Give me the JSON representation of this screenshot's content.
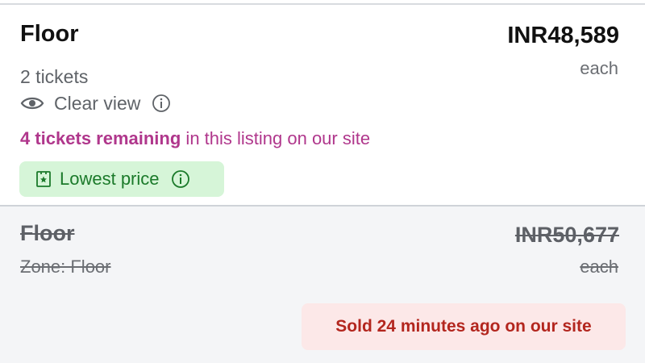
{
  "listing_active": {
    "section": "Floor",
    "price": "INR48,589",
    "price_unit": "each",
    "quantity": "2 tickets",
    "feature": {
      "label": "Clear view",
      "icon": "eye-icon",
      "info_icon": "info-icon"
    },
    "remaining": {
      "highlight": "4 tickets remaining",
      "rest": " in this listing on our site"
    },
    "badge": {
      "label": "Lowest price",
      "icon": "ticket-star-icon",
      "info_icon": "info-icon"
    }
  },
  "listing_sold": {
    "section": "Floor",
    "zone": "Zone: Floor",
    "price": "INR50,677",
    "price_unit": "each",
    "status": "Sold 24 minutes ago on our site"
  },
  "colors": {
    "remaining_text": "#b0378c",
    "badge_bg": "#d6f5d8",
    "badge_text": "#1b7a2a",
    "sold_bg": "#fce8e8",
    "sold_text": "#b3261e"
  }
}
